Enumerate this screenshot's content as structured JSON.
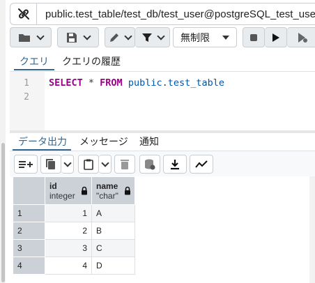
{
  "connection": {
    "title": "public.test_table/test_db/test_user@postgreSQL_test_user"
  },
  "toolbar": {
    "limit_label": "無制限"
  },
  "query_tabs": [
    {
      "label": "クエリ",
      "active": true
    },
    {
      "label": "クエリの履歴",
      "active": false
    }
  ],
  "editor": {
    "line_numbers": [
      "1",
      "2"
    ],
    "code_tokens": [
      {
        "text": "SELECT",
        "kind": "kw"
      },
      {
        "text": " * ",
        "kind": "op"
      },
      {
        "text": "FROM",
        "kind": "kw"
      },
      {
        "text": " public",
        "kind": "id"
      },
      {
        "text": ".",
        "kind": "op"
      },
      {
        "text": "test_table",
        "kind": "id"
      }
    ]
  },
  "output_tabs": [
    {
      "label": "データ出力",
      "active": true
    },
    {
      "label": "メッセージ",
      "active": false
    },
    {
      "label": "通知",
      "active": false
    }
  ],
  "grid": {
    "columns": [
      {
        "name": "id",
        "type": "integer"
      },
      {
        "name": "name",
        "type": "\"char\""
      }
    ],
    "rows": [
      {
        "num": "1",
        "id": "1",
        "name": "A"
      },
      {
        "num": "2",
        "id": "2",
        "name": "B"
      },
      {
        "num": "3",
        "id": "3",
        "name": "C"
      },
      {
        "num": "4",
        "id": "4",
        "name": "D"
      }
    ]
  },
  "colors": {
    "accent": "#326690",
    "header_bg": "#ccd1d8",
    "keyword": "#990088",
    "identifier": "#0055aa"
  }
}
